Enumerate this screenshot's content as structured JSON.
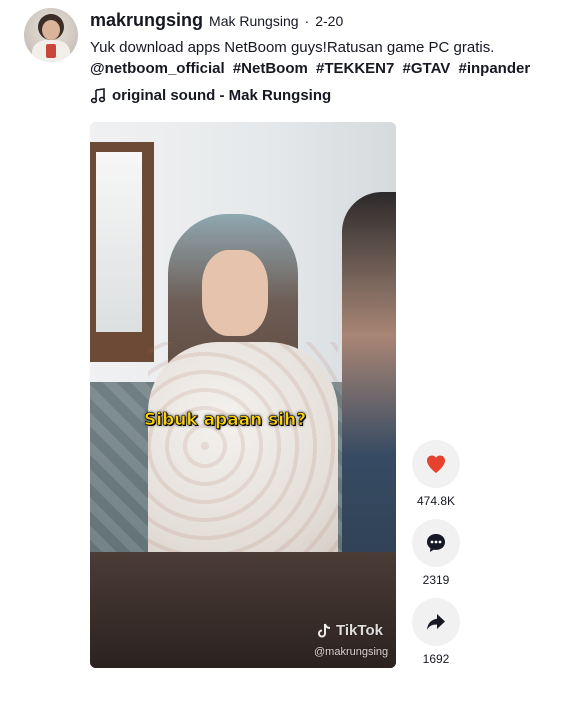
{
  "post": {
    "username": "makrungsing",
    "nickname": "Mak Rungsing",
    "separator": "·",
    "date": "2-20",
    "caption": "Yuk download apps NetBoom guys!Ratusan game PC gratis.",
    "tags": [
      "@netboom_official",
      "#NetBoom",
      "#TEKKEN7",
      "#GTAV",
      "#inpander"
    ]
  },
  "sound": {
    "label": "original sound - Mak Rungsing",
    "icon": "music-note-icon"
  },
  "video": {
    "subtitle": "Sibuk apaan sih?",
    "watermark_brand": "TikTok",
    "watermark_handle": "@makrungsing"
  },
  "actions": {
    "likes": {
      "count": "474.8K",
      "icon": "heart-icon",
      "color": "#e5432e"
    },
    "comments": {
      "count": "2319",
      "icon": "comment-icon",
      "color": "#161823"
    },
    "shares": {
      "count": "1692",
      "icon": "share-arrow-icon",
      "color": "#161823"
    }
  }
}
